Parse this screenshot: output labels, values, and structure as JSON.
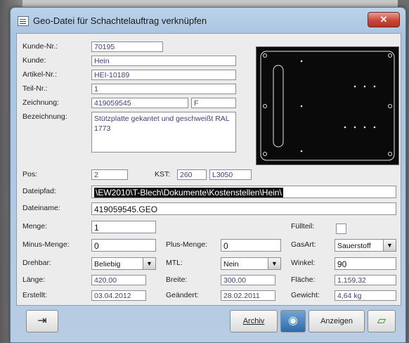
{
  "window": {
    "title": "Geo-Datei für Schachtelauftrag verknüpfen",
    "close": "✕"
  },
  "fields": {
    "kunde_nr": {
      "label": "Kunde-Nr.:",
      "value": "70195"
    },
    "kunde": {
      "label": "Kunde:",
      "value": "Hein"
    },
    "artikel_nr": {
      "label": "Artikel-Nr.:",
      "value": "HEI-10189"
    },
    "teil_nr": {
      "label": "Teil-Nr.:",
      "value": "1"
    },
    "zeichnung": {
      "label": "Zeichnung:",
      "value": "419059545",
      "index": "F"
    },
    "bezeichnung": {
      "label": "Bezeichnung:",
      "value": "Stützplatte gekantet und geschweißt RAL 1773"
    },
    "pos": {
      "label": "Pos:",
      "value": "2"
    },
    "kst": {
      "label": "KST:",
      "value": "260",
      "name": "L3050"
    },
    "dateipfad": {
      "label": "Dateipfad:",
      "value": "\\EW2010\\T-Blech\\Dokumente\\Kostenstellen\\Hein\\"
    },
    "dateiname": {
      "label": "Dateiname:",
      "value": "419059545.GEO"
    },
    "menge": {
      "label": "Menge:",
      "value": "1"
    },
    "fuellteil": {
      "label": "Füllteil:"
    },
    "minus_menge": {
      "label": "Minus-Menge:",
      "value": "0"
    },
    "plus_menge": {
      "label": "Plus-Menge:",
      "value": "0"
    },
    "gasart": {
      "label": "GasArt:",
      "value": "Sauerstoff"
    },
    "drehbar": {
      "label": "Drehbar:",
      "value": "Beliebig"
    },
    "mtl": {
      "label": "MTL:",
      "value": "Nein"
    },
    "winkel": {
      "label": "Winkel:",
      "value": "90"
    },
    "laenge": {
      "label": "Länge:",
      "value": "420,00"
    },
    "breite": {
      "label": "Breite:",
      "value": "300,00"
    },
    "flaeche": {
      "label": "Fläche:",
      "value": "1.159,32"
    },
    "erstellt": {
      "label": "Erstellt:",
      "value": "03.04.2012"
    },
    "geaendert": {
      "label": "Geändert:",
      "value": "28.02.2011"
    },
    "gewicht": {
      "label": "Gewicht:",
      "value": "4,64 kg"
    }
  },
  "buttons": {
    "archiv": "Archiv",
    "anzeigen": "Anzeigen"
  },
  "icons": {
    "exit": "exit-icon",
    "globe": "globe-icon",
    "folder": "open-folder-icon"
  }
}
